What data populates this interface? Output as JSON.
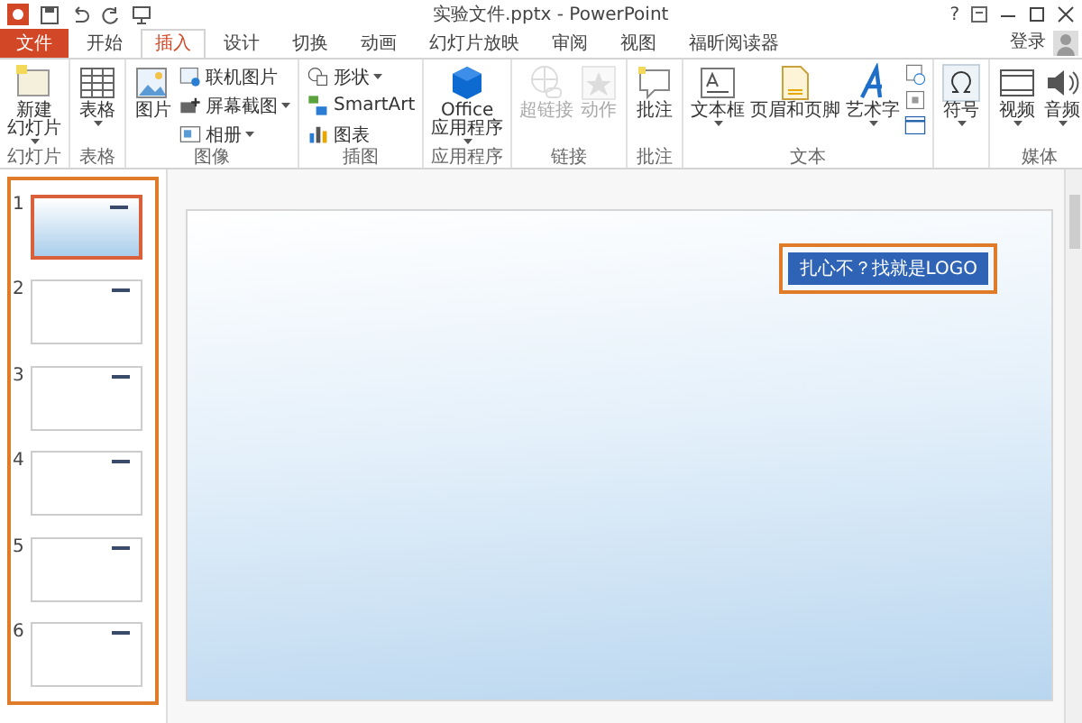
{
  "window": {
    "title": "实验文件.pptx - PowerPoint",
    "help": "?",
    "signin": "登录"
  },
  "tabs": [
    {
      "label": "文件",
      "kind": "file",
      "selected": false
    },
    {
      "label": "开始",
      "kind": "tab",
      "selected": false
    },
    {
      "label": "插入",
      "kind": "tab",
      "selected": true
    },
    {
      "label": "设计",
      "kind": "tab",
      "selected": false
    },
    {
      "label": "切换",
      "kind": "tab",
      "selected": false
    },
    {
      "label": "动画",
      "kind": "tab",
      "selected": false
    },
    {
      "label": "幻灯片放映",
      "kind": "tab",
      "selected": false
    },
    {
      "label": "审阅",
      "kind": "tab",
      "selected": false
    },
    {
      "label": "视图",
      "kind": "tab",
      "selected": false
    },
    {
      "label": "福昕阅读器",
      "kind": "tab",
      "selected": false
    }
  ],
  "ribbon": {
    "groups": [
      {
        "label": "幻灯片",
        "items": [
          {
            "kind": "large",
            "lines": [
              "新建",
              "幻灯片"
            ],
            "dropdown": true,
            "disabled": false
          }
        ]
      },
      {
        "label": "表格",
        "items": [
          {
            "kind": "large",
            "lines": [
              "表格"
            ],
            "dropdown": true,
            "disabled": false
          }
        ]
      },
      {
        "label": "图像",
        "items": [
          {
            "kind": "large",
            "lines": [
              "图片"
            ],
            "dropdown": false,
            "disabled": false
          },
          {
            "kind": "small",
            "lines": [
              "联机图片"
            ],
            "dropdown": false,
            "disabled": false
          },
          {
            "kind": "small",
            "lines": [
              "屏幕截图"
            ],
            "dropdown": true,
            "disabled": false
          },
          {
            "kind": "small",
            "lines": [
              "相册"
            ],
            "dropdown": true,
            "disabled": false
          }
        ]
      },
      {
        "label": "插图",
        "items": [
          {
            "kind": "small",
            "lines": [
              "形状"
            ],
            "dropdown": true,
            "disabled": false
          },
          {
            "kind": "small",
            "lines": [
              "SmartArt"
            ],
            "dropdown": false,
            "disabled": false
          },
          {
            "kind": "small",
            "lines": [
              "图表"
            ],
            "dropdown": false,
            "disabled": false
          }
        ]
      },
      {
        "label": "应用程序",
        "items": [
          {
            "kind": "large",
            "lines": [
              "Office",
              "应用程序"
            ],
            "dropdown": true,
            "disabled": false
          }
        ]
      },
      {
        "label": "链接",
        "items": [
          {
            "kind": "large",
            "lines": [
              "超链接"
            ],
            "dropdown": false,
            "disabled": true
          },
          {
            "kind": "large",
            "lines": [
              "动作"
            ],
            "dropdown": false,
            "disabled": true
          }
        ]
      },
      {
        "label": "批注",
        "items": [
          {
            "kind": "large",
            "lines": [
              "批注"
            ],
            "dropdown": false,
            "disabled": false
          }
        ]
      },
      {
        "label": "文本",
        "items": [
          {
            "kind": "large",
            "lines": [
              "文本框"
            ],
            "dropdown": true,
            "disabled": false
          },
          {
            "kind": "large",
            "lines": [
              "页眉和页脚"
            ],
            "dropdown": false,
            "disabled": false
          },
          {
            "kind": "large",
            "lines": [
              "艺术字"
            ],
            "dropdown": true,
            "disabled": false
          },
          {
            "kind": "iconstack",
            "dropdown": false,
            "disabled": false
          }
        ]
      },
      {
        "items": [
          {
            "kind": "large",
            "lines": [
              "符号"
            ],
            "dropdown": true,
            "disabled": false
          }
        ]
      },
      {
        "label": "媒体",
        "items": [
          {
            "kind": "large",
            "lines": [
              "视频"
            ],
            "dropdown": true,
            "disabled": false
          },
          {
            "kind": "large",
            "lines": [
              "音频"
            ],
            "dropdown": true,
            "disabled": false
          }
        ]
      }
    ]
  },
  "slides": [
    {
      "number": "1",
      "selected": true
    },
    {
      "number": "2",
      "selected": false
    },
    {
      "number": "3",
      "selected": false
    },
    {
      "number": "4",
      "selected": false
    },
    {
      "number": "5",
      "selected": false
    },
    {
      "number": "6",
      "selected": false
    }
  ],
  "slide": {
    "logo_text": "扎心不？找就是LOGO"
  }
}
